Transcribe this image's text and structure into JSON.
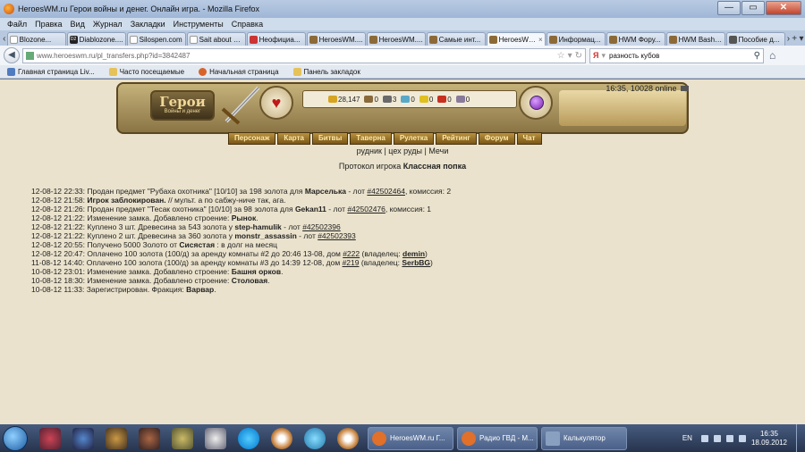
{
  "window": {
    "title": "HeroesWM.ru Герои войны и денег. Онлайн игра. - Mozilla Firefox",
    "minimize": "—",
    "maximize": "▭",
    "close": "✕"
  },
  "menu": [
    "Файл",
    "Правка",
    "Вид",
    "Журнал",
    "Закладки",
    "Инструменты",
    "Справка"
  ],
  "tabs": [
    {
      "label": "Blozone...",
      "icon": "page"
    },
    {
      "label": "Diablozone....",
      "icon": "dz"
    },
    {
      "label": "Silospen.com",
      "icon": "page"
    },
    {
      "label": "Sait about D...",
      "icon": "page"
    },
    {
      "label": "Неофициа...",
      "icon": "wiki"
    },
    {
      "label": "HeroesWM....",
      "icon": "hwm"
    },
    {
      "label": "HeroesWM....",
      "icon": "hwm"
    },
    {
      "label": "Самые инт...",
      "icon": "hwm"
    },
    {
      "label": "HeroesWM...",
      "icon": "hwm",
      "active": true
    },
    {
      "label": "Информац...",
      "icon": "hwm"
    },
    {
      "label": "HWM Фору...",
      "icon": "hwm"
    },
    {
      "label": "HWM Bash ...",
      "icon": "hwm"
    },
    {
      "label": "Пособие д...",
      "icon": "tool"
    }
  ],
  "nav": {
    "url": "www.heroeswm.ru/pl_transfers.php?id=3842487",
    "search_value": "разность кубов",
    "search_engine": "Я"
  },
  "bookmarks": [
    "Главная страница Liv...",
    "Часто посещаемые",
    "Начальная страница",
    "Панель закладок"
  ],
  "header": {
    "logo_line1": "Герои",
    "logo_line2": "Войны и денег",
    "online": "16:35, 10028 online",
    "resources": [
      {
        "value": "28,147",
        "color": "#d6a420"
      },
      {
        "value": "0",
        "color": "#8a6a3a"
      },
      {
        "value": "3",
        "color": "#6a6a6a"
      },
      {
        "value": "0",
        "color": "#5aa8c8"
      },
      {
        "value": "0",
        "color": "#e0c020"
      },
      {
        "value": "0",
        "color": "#c83020"
      },
      {
        "value": "0",
        "color": "#8a7a9a"
      }
    ],
    "menu": [
      "Персонаж",
      "Карта",
      "Битвы",
      "Таверна",
      "Рулетка",
      "Рейтинг",
      "Форум",
      "Чат"
    ]
  },
  "sublinks": {
    "a": "рудник",
    "b": "цех руды",
    "c": "Мечи"
  },
  "heading": {
    "prefix": "Протокол игрока",
    "name": "Классная попка"
  },
  "log": [
    [
      [
        "12-08-12 22:33: Продан предмет \"Рубаха охотника\" [10/10] за 198 золота для ",
        ""
      ],
      [
        "Марселька",
        "b"
      ],
      [
        " - лот ",
        ""
      ],
      [
        "#42502464",
        "u"
      ],
      [
        ", комиссия: 2",
        ""
      ]
    ],
    [
      [
        "12-08-12 21:58: ",
        ""
      ],
      [
        "Игрок заблокирован.",
        "b"
      ],
      [
        " // мульт. а по сабжу-ниче так, ага.",
        ""
      ]
    ],
    [
      [
        "12-08-12 21:26: Продан предмет \"Тесак охотника\" [10/10] за 98 золота для ",
        ""
      ],
      [
        "Gekan11",
        "b"
      ],
      [
        " - лот ",
        ""
      ],
      [
        "#42502476",
        "u"
      ],
      [
        ", комиссия: 1",
        ""
      ]
    ],
    [
      [
        "12-08-12 21:22: Изменение замка. Добавлено строение: ",
        ""
      ],
      [
        "Рынок",
        "b"
      ],
      [
        ".",
        ""
      ]
    ],
    [
      [
        "12-08-12 21:22: Куплено 3 шт. Древесина за 543 золота у ",
        ""
      ],
      [
        "step-hamulik",
        "b"
      ],
      [
        " - лот ",
        ""
      ],
      [
        "#42502396",
        "u"
      ]
    ],
    [
      [
        "12-08-12 21:22: Куплено 2 шт. Древесина за 360 золота у ",
        ""
      ],
      [
        "monstr_assassin",
        "b"
      ],
      [
        " - лот ",
        ""
      ],
      [
        "#42502393",
        "u"
      ]
    ],
    [
      [
        "12-08-12 20:55: Получено 5000 Золото от ",
        ""
      ],
      [
        "Сисястая",
        "b"
      ],
      [
        " : в долг на месяц",
        ""
      ]
    ],
    [
      [
        "12-08-12 20:47: Оплачено 100 золота (100/д) за аренду комнаты #2 до 20:46 13-08, дом ",
        ""
      ],
      [
        "#222",
        "u"
      ],
      [
        " (владелец: ",
        ""
      ],
      [
        "demin",
        "bu"
      ],
      [
        ")",
        ""
      ]
    ],
    [
      [
        "11-08-12 14:40: Оплачено 100 золота (100/д) за аренду комнаты #3 до 14:39 12-08, дом ",
        ""
      ],
      [
        "#219",
        "u"
      ],
      [
        " (владелец: ",
        ""
      ],
      [
        "SerbBG",
        "bu"
      ],
      [
        ")",
        ""
      ]
    ],
    [
      [
        "10-08-12 23:01: Изменение замка. Добавлено строение: ",
        ""
      ],
      [
        "Башня орков",
        "b"
      ],
      [
        ".",
        ""
      ]
    ],
    [
      [
        "10-08-12 18:30: Изменение замка. Добавлено строение: ",
        ""
      ],
      [
        "Столовая",
        "b"
      ],
      [
        ".",
        ""
      ]
    ],
    [
      [
        "10-08-12 11:33: Зарегистрирован. Фракция: ",
        ""
      ],
      [
        "Варвар",
        "b"
      ],
      [
        ".",
        ""
      ]
    ]
  ],
  "taskbar": {
    "tasks": [
      {
        "label": "HeroesWM.ru Г...",
        "icon_color": "#e0702a"
      },
      {
        "label": "Радио ГВД - М...",
        "icon_color": "#e0702a"
      },
      {
        "label": "Калькулятор",
        "icon_color": "#8aa0c0"
      }
    ],
    "lang": "EN",
    "time": "16:35",
    "date": "18.09.2012"
  }
}
